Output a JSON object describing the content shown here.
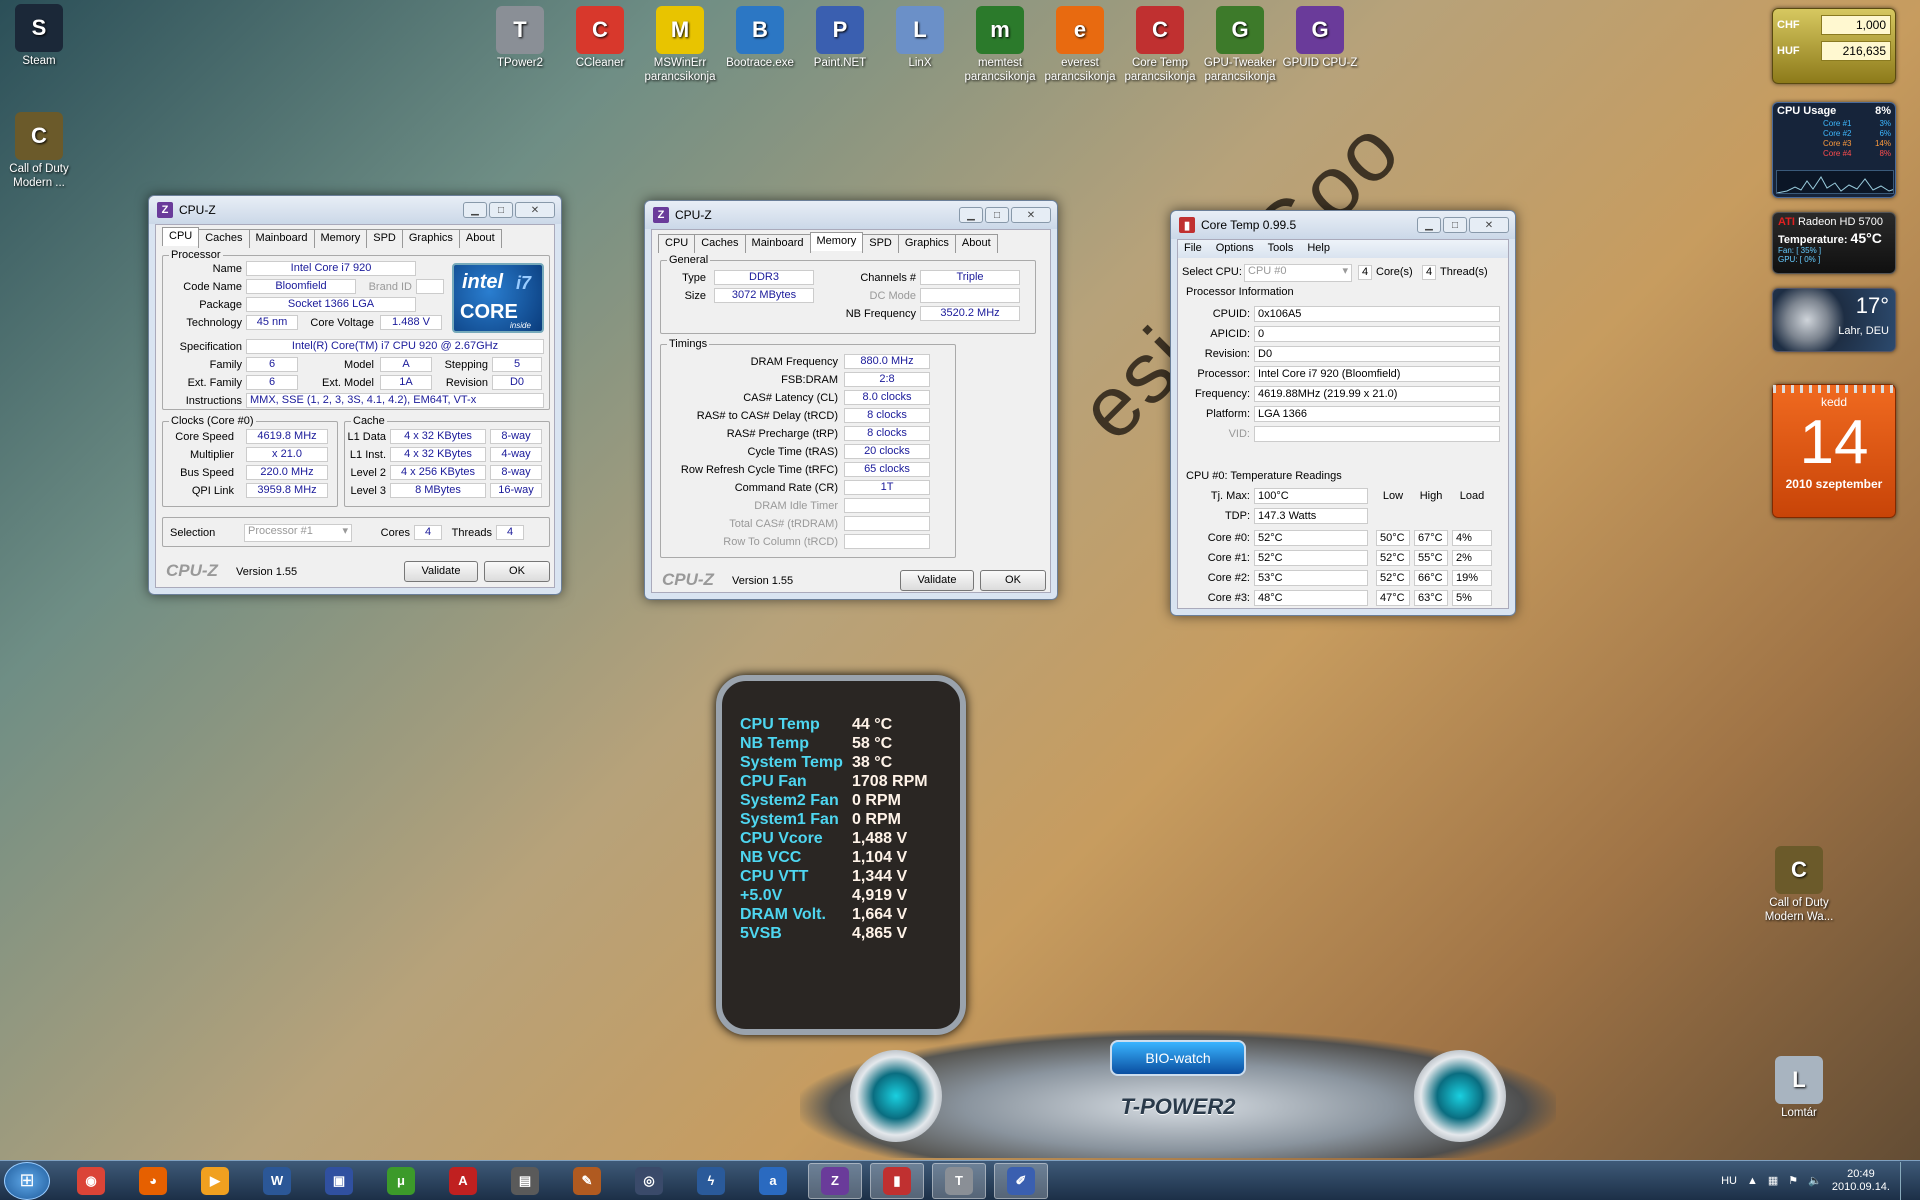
{
  "desktop": {
    "left_icons": [
      {
        "label": "Steam",
        "icon": "steam-icon",
        "color": "#1b2838"
      },
      {
        "label": "Call of Duty Modern ...",
        "icon": "cod-icon",
        "color": "#6b5a2a"
      }
    ],
    "top_icons": [
      {
        "label": "TPower2",
        "icon": "tpower-icon",
        "color": "#8a8f96"
      },
      {
        "label": "CCleaner",
        "icon": "ccleaner-icon",
        "color": "#d8382c"
      },
      {
        "label": "MSWinErr parancsikonja",
        "icon": "warning-icon",
        "color": "#e8c400"
      },
      {
        "label": "Bootrace.exe",
        "icon": "stopwatch-icon",
        "color": "#2c77c4"
      },
      {
        "label": "Paint.NET",
        "icon": "paint-icon",
        "color": "#3a5fb0"
      },
      {
        "label": "LinX",
        "icon": "linx-icon",
        "color": "#6b90c8"
      },
      {
        "label": "memtest parancsikonja",
        "icon": "memtest-icon",
        "color": "#2b7a2b"
      },
      {
        "label": "everest parancsikonja",
        "icon": "info-icon",
        "color": "#e86a10"
      },
      {
        "label": "Core Temp parancsikonja",
        "icon": "thermometer-icon",
        "color": "#c03030"
      },
      {
        "label": "GPU-Tweaker parancsikonja",
        "icon": "ram-icon",
        "color": "#3d7a2a"
      },
      {
        "label": "GPUID CPU-Z",
        "icon": "cpuz-icon",
        "color": "#6a3b9a"
      }
    ],
    "right_icons": [
      {
        "label": "Call of Duty Modern Wa...",
        "icon": "cod-icon",
        "color": "#6b5a2a"
      },
      {
        "label": "Lomtár",
        "icon": "recycle-bin-icon",
        "color": "#a8b4c0"
      }
    ],
    "wallpaper_text": "esign Goo"
  },
  "cpuz1": {
    "title": "CPU-Z",
    "tabs": [
      "CPU",
      "Caches",
      "Mainboard",
      "Memory",
      "SPD",
      "Graphics",
      "About"
    ],
    "processor_group": "Processor",
    "name_l": "Name",
    "name": "Intel Core i7 920",
    "code_l": "Code Name",
    "code": "Bloomfield",
    "brand_l": "Brand ID",
    "brand": "",
    "pkg_l": "Package",
    "pkg": "Socket 1366 LGA",
    "tech_l": "Technology",
    "tech": "45 nm",
    "volt_l": "Core Voltage",
    "volt": "1.488 V",
    "spec_l": "Specification",
    "spec": "Intel(R) Core(TM) i7 CPU      920  @ 2.67GHz",
    "fam_l": "Family",
    "fam": "6",
    "model_l": "Model",
    "model": "A",
    "step_l": "Stepping",
    "step": "5",
    "efam_l": "Ext. Family",
    "efam": "6",
    "emod_l": "Ext. Model",
    "emod": "1A",
    "rev_l": "Revision",
    "rev": "D0",
    "instr_l": "Instructions",
    "instr": "MMX, SSE (1, 2, 3, 3S, 4.1, 4.2), EM64T, VT-x",
    "logo1": "intel",
    "logo2": "CORE",
    "logo3": "i7",
    "logo4": "inside",
    "clocks_group": "Clocks (Core #0)",
    "cs_l": "Core Speed",
    "cs": "4619.8 MHz",
    "mul_l": "Multiplier",
    "mul": "x 21.0",
    "bus_l": "Bus Speed",
    "bus": "220.0 MHz",
    "qpi_l": "QPI Link",
    "qpi": "3959.8 MHz",
    "cache_group": "Cache",
    "l1d_l": "L1 Data",
    "l1d": "4 x 32 KBytes",
    "l1d_w": "8-way",
    "l1i_l": "L1 Inst.",
    "l1i": "4 x 32 KBytes",
    "l1i_w": "4-way",
    "l2_l": "Level 2",
    "l2": "4 x 256 KBytes",
    "l2_w": "8-way",
    "l3_l": "Level 3",
    "l3": "8 MBytes",
    "l3_w": "16-way",
    "sel_l": "Selection",
    "sel": "Processor #1",
    "cores_l": "Cores",
    "cores": "4",
    "thr_l": "Threads",
    "thr": "4",
    "brand_logo": "CPU-Z",
    "version": "Version 1.55",
    "validate": "Validate",
    "ok": "OK"
  },
  "cpuz2": {
    "title": "CPU-Z",
    "tabs": [
      "CPU",
      "Caches",
      "Mainboard",
      "Memory",
      "SPD",
      "Graphics",
      "About"
    ],
    "general_group": "General",
    "type_l": "Type",
    "type": "DDR3",
    "size_l": "Size",
    "size": "3072 MBytes",
    "ch_l": "Channels #",
    "ch": "Triple",
    "dc_l": "DC Mode",
    "dc": "",
    "nb_l": "NB Frequency",
    "nb": "3520.2 MHz",
    "timings_group": "Timings",
    "timings": [
      {
        "l": "DRAM Frequency",
        "v": "880.0 MHz",
        "dis": false
      },
      {
        "l": "FSB:DRAM",
        "v": "2:8",
        "dis": false
      },
      {
        "l": "CAS# Latency (CL)",
        "v": "8.0 clocks",
        "dis": false
      },
      {
        "l": "RAS# to CAS# Delay (tRCD)",
        "v": "8 clocks",
        "dis": false
      },
      {
        "l": "RAS# Precharge (tRP)",
        "v": "8 clocks",
        "dis": false
      },
      {
        "l": "Cycle Time (tRAS)",
        "v": "20 clocks",
        "dis": false
      },
      {
        "l": "Row Refresh Cycle Time (tRFC)",
        "v": "65 clocks",
        "dis": false
      },
      {
        "l": "Command Rate (CR)",
        "v": "1T",
        "dis": false
      },
      {
        "l": "DRAM Idle Timer",
        "v": "",
        "dis": true
      },
      {
        "l": "Total CAS# (tRDRAM)",
        "v": "",
        "dis": true
      },
      {
        "l": "Row To Column (tRCD)",
        "v": "",
        "dis": true
      }
    ],
    "brand_logo": "CPU-Z",
    "version": "Version 1.55",
    "validate": "Validate",
    "ok": "OK"
  },
  "coretemp": {
    "title": "Core Temp 0.99.5",
    "menu": [
      "File",
      "Options",
      "Tools",
      "Help"
    ],
    "sel_l": "Select CPU:",
    "sel": "CPU #0",
    "cores": "4",
    "cores_l": "Core(s)",
    "thr": "4",
    "thr_l": "Thread(s)",
    "pi": "Processor Information",
    "info": [
      {
        "l": "CPUID:",
        "v": "0x106A5"
      },
      {
        "l": "APICID:",
        "v": "0"
      },
      {
        "l": "Revision:",
        "v": "D0"
      },
      {
        "l": "Processor:",
        "v": "Intel Core i7 920 (Bloomfield)"
      },
      {
        "l": "Frequency:",
        "v": "4619.88MHz (219.99 x 21.0)"
      },
      {
        "l": "Platform:",
        "v": "LGA 1366"
      },
      {
        "l": "VID:",
        "v": ""
      }
    ],
    "tr": "CPU #0: Temperature Readings",
    "tj_l": "Tj. Max:",
    "tj": "100°C",
    "tdp_l": "TDP:",
    "tdp": "147.3 Watts",
    "h_low": "Low",
    "h_high": "High",
    "h_load": "Load",
    "cores_list": [
      {
        "l": "Core #0:",
        "t": "52°C",
        "lo": "50°C",
        "hi": "67°C",
        "ld": "4%"
      },
      {
        "l": "Core #1:",
        "t": "52°C",
        "lo": "52°C",
        "hi": "55°C",
        "ld": "2%"
      },
      {
        "l": "Core #2:",
        "t": "53°C",
        "lo": "52°C",
        "hi": "66°C",
        "ld": "19%"
      },
      {
        "l": "Core #3:",
        "t": "48°C",
        "lo": "47°C",
        "hi": "63°C",
        "ld": "5%"
      }
    ]
  },
  "gadgets": {
    "currency": [
      {
        "c": "CHF",
        "v": "1,000"
      },
      {
        "c": "HUF",
        "v": "216,635"
      }
    ],
    "cpu": {
      "title": "CPU Usage",
      "total": "8%",
      "cores": [
        {
          "l": "Core #1",
          "v": "3%",
          "c": "#3db8ff"
        },
        {
          "l": "Core #2",
          "v": "6%",
          "c": "#3db8ff"
        },
        {
          "l": "Core #3",
          "v": "14%",
          "c": "#ff9b3d"
        },
        {
          "l": "Core #4",
          "v": "8%",
          "c": "#ff4d4d"
        }
      ]
    },
    "gpu": {
      "brand": "ATI",
      "model": "Radeon HD 5700",
      "temp_l": "Temperature:",
      "temp": "45°C",
      "fan": "Fan: [ 35% ]",
      "gpu": "GPU: [ 0% ]"
    },
    "weather": {
      "temp": "17°",
      "loc": "Lahr, DEU"
    },
    "cal": {
      "day": "kedd",
      "date": "14",
      "month": "2010 szeptember"
    }
  },
  "bio": {
    "title": "BIO-watch",
    "brand": "T-POWER2",
    "rows": [
      {
        "k": "CPU Temp",
        "v": "44 °C"
      },
      {
        "k": "NB Temp",
        "v": "58 °C"
      },
      {
        "k": "System Temp",
        "v": "38 °C"
      },
      {
        "k": "CPU Fan",
        "v": "1708 RPM"
      },
      {
        "k": "System2 Fan",
        "v": "0 RPM"
      },
      {
        "k": "System1 Fan",
        "v": "0 RPM"
      },
      {
        "k": "CPU Vcore",
        "v": "1,488 V"
      },
      {
        "k": "NB VCC",
        "v": "1,104 V"
      },
      {
        "k": "CPU VTT",
        "v": "1,344 V"
      },
      {
        "k": "+5.0V",
        "v": "4,919 V"
      },
      {
        "k": "DRAM Volt.",
        "v": "1,664 V"
      },
      {
        "k": "5VSB",
        "v": "4,865 V"
      }
    ]
  },
  "taskbar": {
    "apps": [
      {
        "n": "chrome-icon",
        "c": "#db4437",
        "t": "◉",
        "a": false
      },
      {
        "n": "firefox-icon",
        "c": "#e66000",
        "t": "◕",
        "a": false
      },
      {
        "n": "media-player-icon",
        "c": "#f0a020",
        "t": "▶",
        "a": false
      },
      {
        "n": "word-icon",
        "c": "#2b5797",
        "t": "W",
        "a": false
      },
      {
        "n": "save-icon",
        "c": "#3050a0",
        "t": "▣",
        "a": false
      },
      {
        "n": "utorrent-icon",
        "c": "#3c9a2a",
        "t": "μ",
        "a": false
      },
      {
        "n": "pdf-icon",
        "c": "#c02020",
        "t": "A",
        "a": false
      },
      {
        "n": "pinnacle-icon",
        "c": "#5a5a5a",
        "t": "▤",
        "a": false
      },
      {
        "n": "tool-icon",
        "c": "#b05a20",
        "t": "✎",
        "a": false
      },
      {
        "n": "eye-icon",
        "c": "#3a4a6a",
        "t": "◎",
        "a": false
      },
      {
        "n": "hp-icon",
        "c": "#2a5a9a",
        "t": "ϟ",
        "a": false
      },
      {
        "n": "avast-icon",
        "c": "#2a6ac0",
        "t": "a",
        "a": false
      },
      {
        "n": "cpuz-icon",
        "c": "#6a3b9a",
        "t": "Z",
        "a": true
      },
      {
        "n": "coretemp-icon",
        "c": "#c03030",
        "t": "▮",
        "a": true
      },
      {
        "n": "tpower-icon",
        "c": "#8a8f96",
        "t": "T",
        "a": true
      },
      {
        "n": "paint-icon",
        "c": "#3a5fb0",
        "t": "✐",
        "a": true
      }
    ],
    "lang": "HU",
    "time": "20:49",
    "date": "2010.09.14."
  }
}
